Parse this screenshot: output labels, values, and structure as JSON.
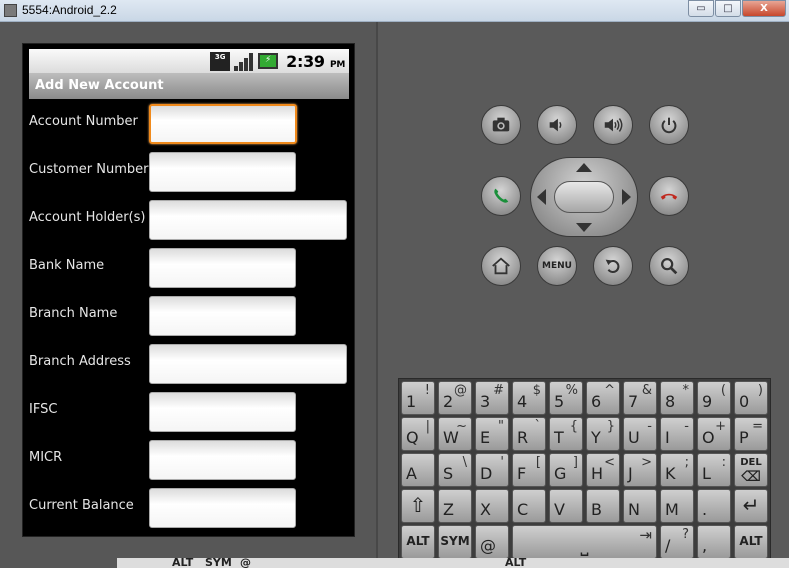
{
  "window": {
    "title": "5554:Android_2.2",
    "minimize": "▭",
    "maximize": "□",
    "close": "X"
  },
  "statusbar": {
    "network": "3G",
    "battery_icon": "⚡",
    "time": "2:39",
    "ampm": "PM"
  },
  "app": {
    "title": "Add New Account"
  },
  "form": {
    "fields": [
      {
        "label": "Account Number",
        "value": ""
      },
      {
        "label": "Customer Number",
        "value": ""
      },
      {
        "label": "Account Holder(s)",
        "value": ""
      },
      {
        "label": "Bank Name",
        "value": ""
      },
      {
        "label": "Branch Name",
        "value": ""
      },
      {
        "label": "Branch Address",
        "value": ""
      },
      {
        "label": "IFSC",
        "value": ""
      },
      {
        "label": "MICR",
        "value": ""
      },
      {
        "label": "Current Balance",
        "value": ""
      }
    ]
  },
  "hardware": {
    "menu_label": "MENU"
  },
  "keyboard": {
    "row1": [
      [
        "1",
        "!"
      ],
      [
        "2",
        "@"
      ],
      [
        "3",
        "#"
      ],
      [
        "4",
        "$"
      ],
      [
        "5",
        "%"
      ],
      [
        "6",
        "^"
      ],
      [
        "7",
        "&"
      ],
      [
        "8",
        "*"
      ],
      [
        "9",
        "("
      ],
      [
        "0",
        ")"
      ]
    ],
    "row2": [
      [
        "Q",
        "|"
      ],
      [
        "W",
        "~"
      ],
      [
        "E",
        "\""
      ],
      [
        "R",
        "`"
      ],
      [
        "T",
        "{"
      ],
      [
        "Y",
        "}"
      ],
      [
        "U",
        "-"
      ],
      [
        "I",
        "-"
      ],
      [
        "O",
        "+"
      ],
      [
        "P",
        "="
      ]
    ],
    "row3": [
      [
        "A",
        ""
      ],
      [
        "S",
        "\\"
      ],
      [
        "D",
        "'"
      ],
      [
        "F",
        "["
      ],
      [
        "G",
        "]"
      ],
      [
        "H",
        "<"
      ],
      [
        "J",
        ">"
      ],
      [
        "K",
        ";"
      ],
      [
        "L",
        ":"
      ]
    ],
    "del_label": "DEL",
    "row4": [
      "Z",
      "X",
      "C",
      "V",
      "B",
      "N",
      "M",
      "."
    ],
    "shift": "⇧",
    "enter": "↵",
    "alt_label": "ALT",
    "sym_label": "SYM",
    "at_label": "@",
    "space_glyph": "⎵",
    "tab_glyph": "⇥",
    "slash_key": [
      "/",
      "?"
    ],
    "comma_key": ","
  },
  "bottom": {
    "alt1": "ALT",
    "sym": "SYM",
    "at": "@",
    "alt2": "ALT"
  }
}
